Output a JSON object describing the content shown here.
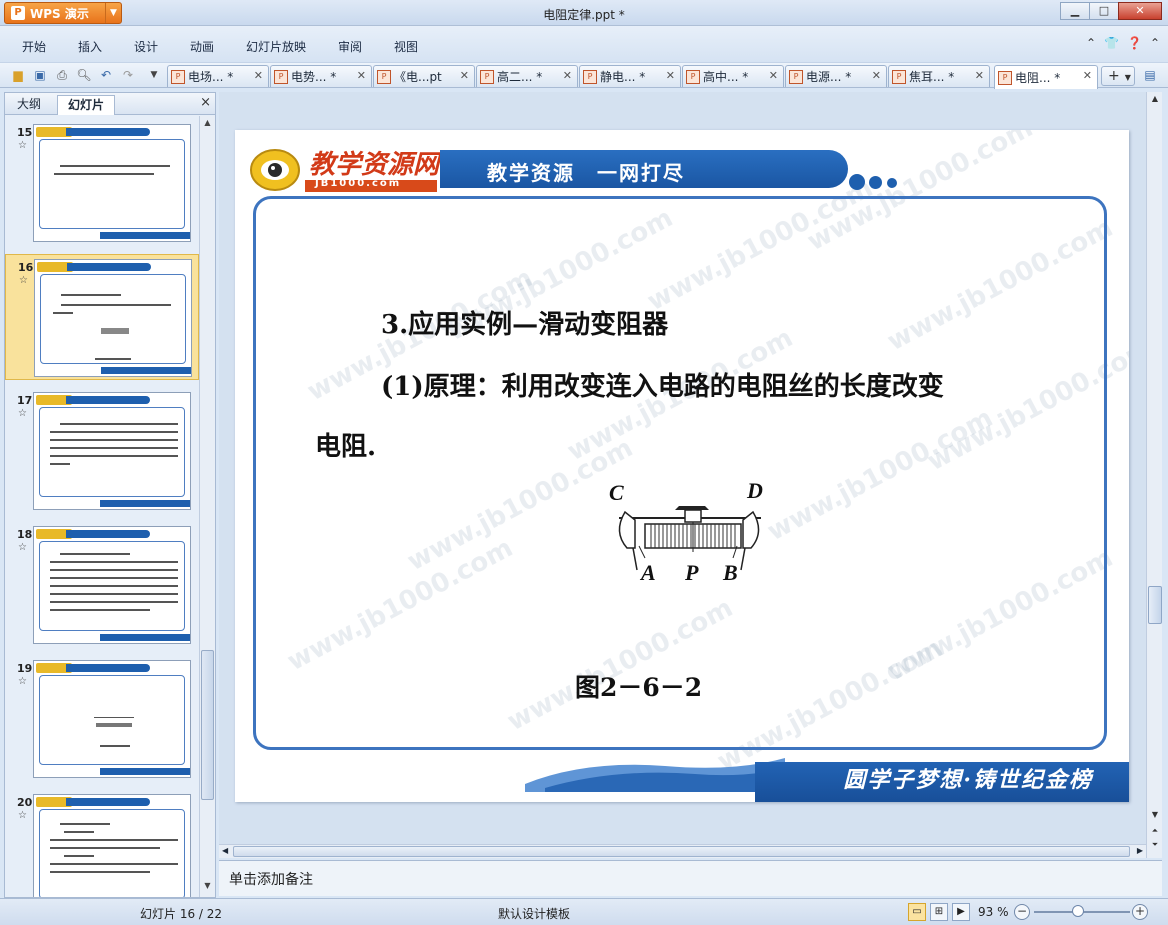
{
  "app": {
    "name": "WPS 演示",
    "document_title": "电阻定律.ppt *"
  },
  "menu": [
    "开始",
    "插入",
    "设计",
    "动画",
    "幻灯片放映",
    "审阅",
    "视图"
  ],
  "tabs": [
    {
      "label": "电场... *"
    },
    {
      "label": "电势... *"
    },
    {
      "label": "《电...pt"
    },
    {
      "label": "高二... *"
    },
    {
      "label": "静电... *"
    },
    {
      "label": "高中... *"
    },
    {
      "label": "电源... *"
    },
    {
      "label": "焦耳... *"
    },
    {
      "label": "电阻... *",
      "active": true
    }
  ],
  "left_panel": {
    "tabs": [
      "大纲",
      "幻灯片"
    ],
    "active_tab": "幻灯片",
    "close": "×",
    "thumbnails": [
      {
        "number": "15",
        "star": "☆"
      },
      {
        "number": "16",
        "star": "☆",
        "selected": true
      },
      {
        "number": "17",
        "star": "☆"
      },
      {
        "number": "18",
        "star": "☆"
      },
      {
        "number": "19",
        "star": "☆"
      },
      {
        "number": "20",
        "star": "☆"
      }
    ]
  },
  "slide": {
    "banner_logo_text": "教学资源网",
    "banner_logo_url": "JB1000.com",
    "banner_text": "教学资源　一网打尽",
    "heading": "3.应用实例—滑动变阻器",
    "line1": "(1)原理：利用改变连入电路的电阻丝的长度改变",
    "line2": "电阻.",
    "figure_labels": {
      "C": "C",
      "D": "D",
      "A": "A",
      "P": "P",
      "B": "B"
    },
    "figure_caption": "图2－6－2",
    "watermark": "www.jb1000.com",
    "footer_text": "圆学子梦想·铸世纪金榜"
  },
  "notes_placeholder": "单击添加备注",
  "status": {
    "slide_indicator": "幻灯片 16 / 22",
    "template": "默认设计模板",
    "zoom": "93 %"
  }
}
